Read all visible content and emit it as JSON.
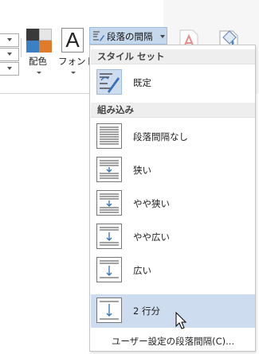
{
  "ribbon": {
    "color_label": "配色",
    "font_label": "フォント",
    "font_glyph": "A",
    "paragraph_spacing_label": "段落の間隔",
    "colors": {
      "scheme1": "#3a3a3a",
      "scheme2": "#e6e6e6",
      "scheme3": "#3b7fc4",
      "scheme4": "#e07b2a",
      "button_active": "#c5d8ec"
    }
  },
  "menu": {
    "section_style_set": "スタイル セット",
    "default_label": "既定",
    "section_builtin": "組み込み",
    "items": [
      {
        "label": "段落間隔なし",
        "icon": "spacing-none-icon"
      },
      {
        "label": "狭い",
        "icon": "spacing-compact-icon"
      },
      {
        "label": "やや狭い",
        "icon": "spacing-tight-icon"
      },
      {
        "label": "やや広い",
        "icon": "spacing-open-icon"
      },
      {
        "label": "広い",
        "icon": "spacing-relaxed-icon"
      },
      {
        "label": "2 行分",
        "icon": "spacing-double-icon",
        "highlighted": true
      }
    ],
    "custom_label": "ユーザー設定の段落間隔(C)...",
    "hover_color": "#cddcef"
  }
}
